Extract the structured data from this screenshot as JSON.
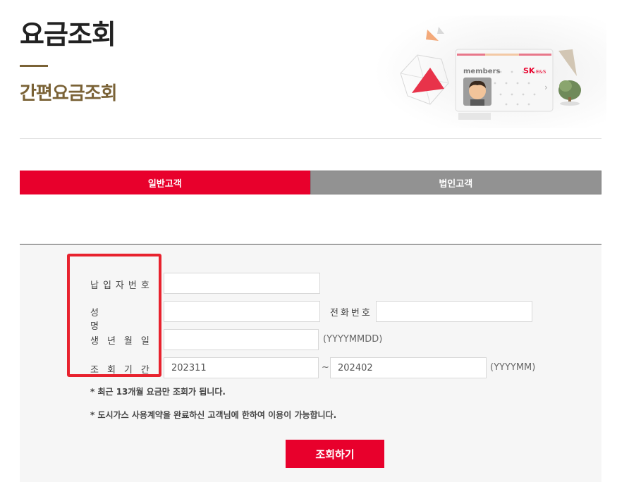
{
  "header": {
    "title": "요금조회",
    "subtitle": "간편요금조회"
  },
  "hero": {
    "card_label": "members",
    "brand": "SK",
    "brand_sub": "E&S"
  },
  "tabs": [
    {
      "label": "일반고객",
      "active": true
    },
    {
      "label": "법인고객",
      "active": false
    }
  ],
  "form": {
    "fields": {
      "payer_number": {
        "label": "납입자번호",
        "value": ""
      },
      "name": {
        "label": "성명",
        "value": ""
      },
      "phone": {
        "label": "전화번호",
        "value": ""
      },
      "birthdate": {
        "label": "생년월일",
        "value": "",
        "hint": "(YYYYMMDD)"
      },
      "period": {
        "label": "조회기간",
        "from": "202311",
        "separator": "~",
        "to": "202402",
        "hint": "(YYYYMM)"
      }
    },
    "notes": [
      "* 최근 13개월 요금만 조회가 됩니다.",
      "* 도시가스 사용계약을 완료하신 고객님에 한하여 이용이 가능합니다."
    ],
    "submit_label": "조회하기"
  },
  "colors": {
    "accent_red": "#e8002c",
    "brown": "#7a6236",
    "tab_gray": "#929292",
    "highlight": "#e8222e"
  }
}
